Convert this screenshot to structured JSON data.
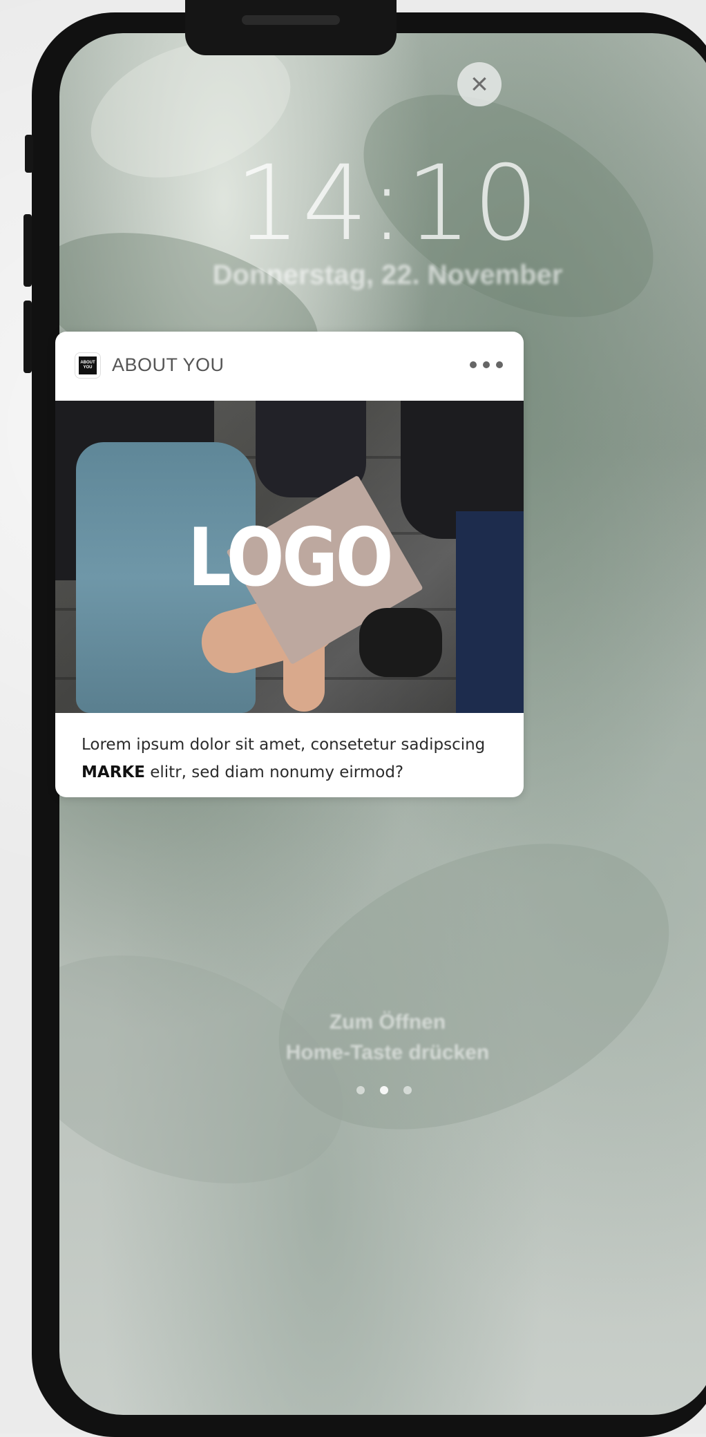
{
  "lock_screen": {
    "time": "14:10",
    "date": "Donnerstag, 22. November",
    "unlock_hint_line1": "Zum Öffnen",
    "unlock_hint_line2": "Home-Taste drücken"
  },
  "close_button": {
    "icon": "close-icon",
    "glyph": "×"
  },
  "notification": {
    "app_icon_text": "ABOUT YOU",
    "app_name": "ABOUT YOU",
    "more_icon": "more-icon",
    "image_logo_text": "LOGO",
    "message_part1": "Lorem ipsum dolor sit amet, consetetur sadipscing ",
    "message_brand": "MARKE",
    "message_part2": " elitr, sed diam nonumy eirmod?"
  },
  "colors": {
    "phone_frame": "#111111",
    "card_background": "#ffffff",
    "text": "#2b2b2b"
  }
}
